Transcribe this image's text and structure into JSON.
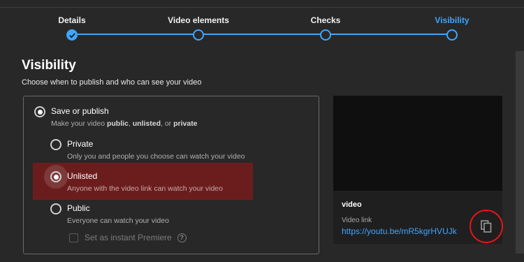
{
  "steps": [
    {
      "label": "Details",
      "state": "done"
    },
    {
      "label": "Video elements",
      "state": "pending"
    },
    {
      "label": "Checks",
      "state": "pending"
    },
    {
      "label": "Visibility",
      "state": "active"
    }
  ],
  "page": {
    "title": "Visibility",
    "subtitle": "Choose when to publish and who can see your video"
  },
  "options": {
    "save_publish": {
      "label": "Save or publish",
      "desc_prefix": "Make your video ",
      "desc_public": "public",
      "desc_sep1": ", ",
      "desc_unlisted": "unlisted",
      "desc_sep2": ", or ",
      "desc_private": "private",
      "selected": true
    },
    "private": {
      "label": "Private",
      "desc": "Only you and people you choose can watch your video",
      "selected": false
    },
    "unlisted": {
      "label": "Unlisted",
      "desc": "Anyone with the video link can watch your video",
      "selected": true
    },
    "public": {
      "label": "Public",
      "desc": "Everyone can watch your video",
      "selected": false
    },
    "premiere": {
      "label": "Set as instant Premiere",
      "checked": false
    }
  },
  "preview": {
    "video_name": "video",
    "link_label": "Video link",
    "link_url": "https://youtu.be/mR5kgrHVUJk"
  },
  "icons": {
    "help": "?",
    "copy": "copy-icon",
    "check": "check-icon"
  },
  "colors": {
    "accent": "#3ea6ff",
    "highlight": "#6b1d1d",
    "annotation_circle": "#e01616",
    "background": "#282828"
  }
}
